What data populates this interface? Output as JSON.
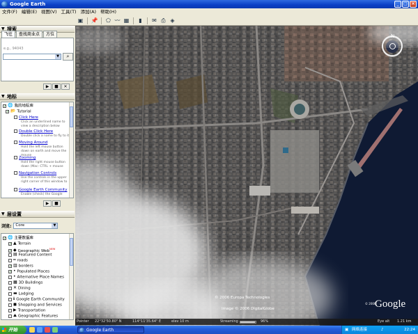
{
  "window": {
    "title": "Google Earth"
  },
  "menu": [
    "文件(F)",
    "编辑(E)",
    "视图(V)",
    "工具(T)",
    "添加(A)",
    "帮助(H)"
  ],
  "toolbar": {
    "icons": [
      "sidebar-toggle-icon",
      "placemark-icon",
      "polygon-icon",
      "path-icon",
      "image-overlay-icon",
      "ruler-icon",
      "email-icon",
      "print-icon",
      "google-maps-icon"
    ]
  },
  "search_panel": {
    "title": "搜索",
    "tabs": [
      "飞往",
      "查找商业点",
      "方位"
    ],
    "hint": "e.g., 94043",
    "input_value": "",
    "search_button_icon": "magnifier-icon"
  },
  "places_panel": {
    "title": "地标",
    "items": [
      {
        "label": "我的地标库",
        "icon": "globe-icon",
        "checked": true,
        "indent": 0
      },
      {
        "label": "Tutorial",
        "icon": "folder-icon",
        "checked": true,
        "indent": 1
      },
      {
        "label": "Click Here",
        "link": true,
        "indent": 2,
        "desc": "Click an underlined name to view a description below"
      },
      {
        "label": "Double Click Here",
        "link": true,
        "indent": 2,
        "desc": "Double click a name to fly to it"
      },
      {
        "label": "Moving Around",
        "link": true,
        "indent": 2,
        "desc": "Hold the left mouse button down on earth and move the mouse"
      },
      {
        "label": "Zooming",
        "link": true,
        "indent": 2,
        "desc": "Hold the right mouse button down (Mac: CTRL + mouse"
      },
      {
        "label": "Navigation Controls",
        "link": true,
        "indent": 2,
        "desc": "Use the controls in the upper right corner of this window to"
      },
      {
        "label": "Google Earth Community",
        "link": true,
        "indent": 2,
        "desc": "Enable (check) the Google"
      }
    ]
  },
  "layers_panel": {
    "title": "层设置",
    "view_label": "浏览:",
    "view_value": "Core",
    "items": [
      {
        "label": "主要数据库",
        "checked": true,
        "indent": 0,
        "icon": "globe-icon"
      },
      {
        "label": "Terrain",
        "checked": true,
        "indent": 1,
        "icon": "terrain-icon"
      },
      {
        "label": "Geographic Web",
        "badge": "NEW",
        "checked": true,
        "indent": 1,
        "icon": "geoweb-icon"
      },
      {
        "label": "Featured Content",
        "checked": false,
        "indent": 1,
        "icon": "folder-icon"
      },
      {
        "label": "roads",
        "checked": false,
        "indent": 1,
        "icon": "road-icon"
      },
      {
        "label": "borders",
        "checked": true,
        "indent": 1,
        "icon": "border-icon"
      },
      {
        "label": "Populated Places",
        "checked": true,
        "indent": 1,
        "icon": "dot-icon"
      },
      {
        "label": "Alternative Place Names",
        "checked": false,
        "indent": 1,
        "icon": "dot-icon"
      },
      {
        "label": "3D Buildings",
        "checked": false,
        "indent": 1,
        "icon": "building-icon"
      },
      {
        "label": "Dining",
        "checked": false,
        "indent": 1,
        "icon": "dining-icon"
      },
      {
        "label": "Lodging",
        "checked": false,
        "indent": 1,
        "icon": "lodging-icon"
      },
      {
        "label": "Google Earth Community",
        "checked": false,
        "indent": 1,
        "icon": "info-icon"
      },
      {
        "label": "Shopping and Services",
        "checked": false,
        "indent": 1,
        "icon": "shopping-icon"
      },
      {
        "label": "Transportation",
        "checked": false,
        "indent": 1,
        "icon": "transport-icon"
      },
      {
        "label": "Geographic Features",
        "checked": false,
        "indent": 1,
        "icon": "mountain-icon"
      }
    ]
  },
  "map": {
    "copyright1": "© 2006 Europa Technologies",
    "copyright2": "Image © 2006 DigitalGlobe",
    "logo": "Google",
    "logo_prefix": "© 2006"
  },
  "status": {
    "pointer": "Pointer",
    "lat": "22°32'50.80\" N",
    "lon": "114°11'35.64\" E",
    "elev": "elev   10 m",
    "streaming": "Streaming",
    "percent": "96%",
    "eye_alt": "Eye alt",
    "eye_value": "1.21 km"
  },
  "taskbar": {
    "start": "开始",
    "task": "Google Earth",
    "tray_text": "网络连接",
    "clock": "22:24"
  },
  "colors": {
    "titlebar": "#0A3FC6",
    "water": "#0f1a33"
  }
}
